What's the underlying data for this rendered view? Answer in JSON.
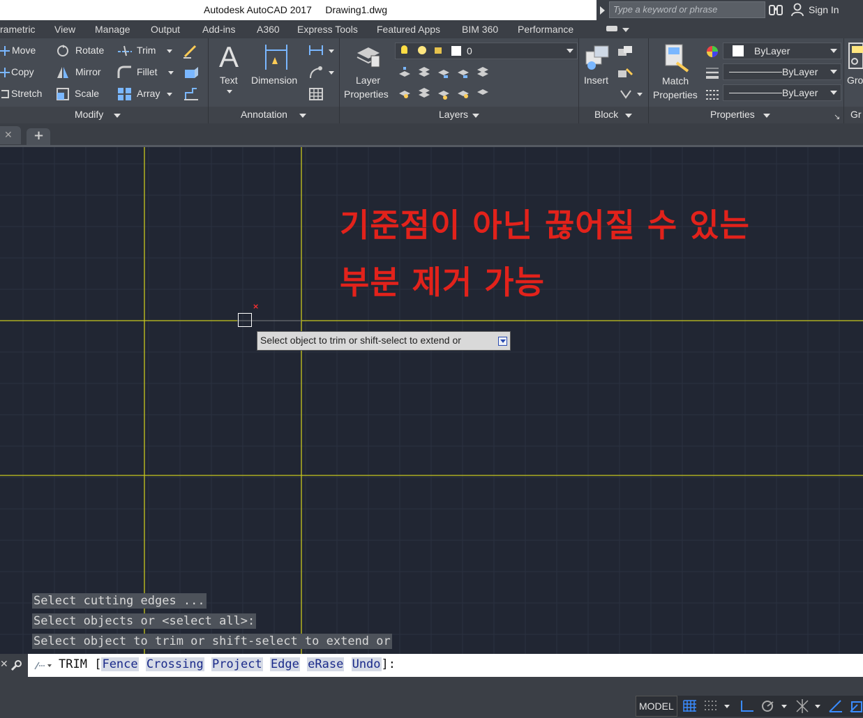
{
  "window": {
    "app_name": "Autodesk AutoCAD 2017",
    "file_name": "Drawing1.dwg",
    "search_placeholder": "Type a keyword or phrase",
    "sign_in": "Sign In"
  },
  "ribbon_tabs": [
    "rametric",
    "View",
    "Manage",
    "Output",
    "Add-ins",
    "A360",
    "Express Tools",
    "Featured Apps",
    "BIM 360",
    "Performance"
  ],
  "modify": {
    "move": "Move",
    "rotate": "Rotate",
    "trim": "Trim",
    "copy": "Copy",
    "mirror": "Mirror",
    "fillet": "Fillet",
    "stretch": "Stretch",
    "scale": "Scale",
    "array": "Array",
    "panel": "Modify"
  },
  "annotation": {
    "text": "Text",
    "dimension": "Dimension",
    "panel": "Annotation"
  },
  "layers": {
    "layer_properties_1": "Layer",
    "layer_properties_2": "Properties",
    "current_layer": "0",
    "panel": "Layers"
  },
  "block": {
    "insert": "Insert",
    "panel": "Block"
  },
  "properties": {
    "match_1": "Match",
    "match_2": "Properties",
    "color": "ByLayer",
    "linetype": "ByLayer",
    "lineweight": "ByLayer",
    "panel": "Properties"
  },
  "groups": {
    "label_top": "Gro",
    "label_bottom": "Gr"
  },
  "annotation_text": {
    "line1": "기준점이 아닌 끊어질 수 있는",
    "line2": "부분 제거 가능"
  },
  "tooltip": "Select object to trim or shift-select to extend or",
  "history": [
    "Select cutting edges ...",
    "Select objects or <select all>:",
    "Select object to trim or shift-select to extend or"
  ],
  "command": {
    "name": "TRIM",
    "open": "[",
    "options": [
      {
        "key": "F",
        "rest": "ence"
      },
      {
        "key": "C",
        "rest": "rossing"
      },
      {
        "key": "P",
        "rest": "roject"
      },
      {
        "key": "E",
        "rest": "dge"
      },
      {
        "key": "eR",
        "rest": "ase"
      },
      {
        "key": "U",
        "rest": "ndo"
      }
    ],
    "close": "]:"
  },
  "status": {
    "model": "MODEL"
  },
  "colors": {
    "canvas_bg": "#212633",
    "grid_line": "#2b3140",
    "yellow_line": "#c8c81e",
    "annotation_red": "#e2221b"
  }
}
